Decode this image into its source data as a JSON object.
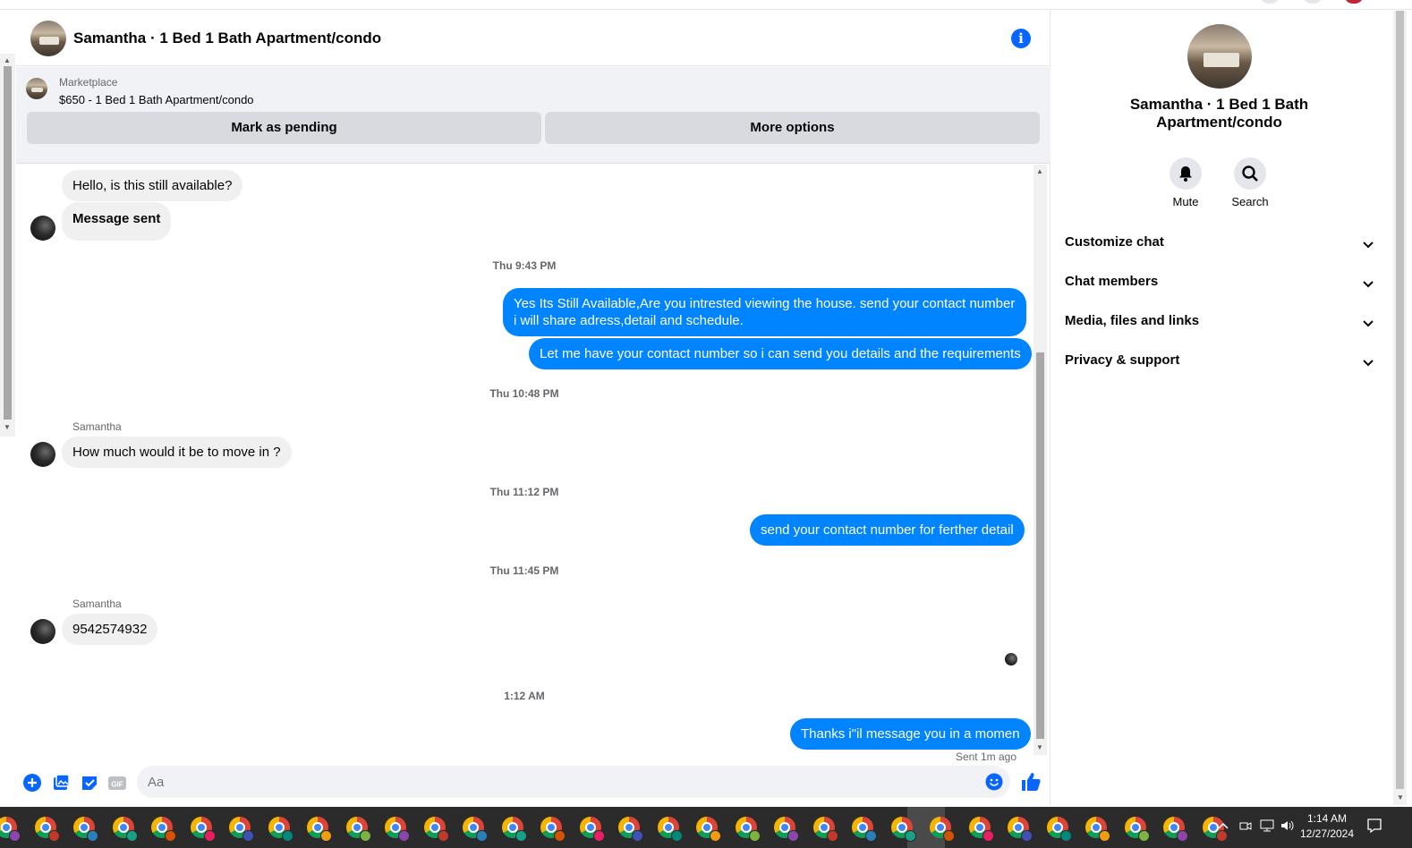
{
  "chat": {
    "title": "Samantha · 1 Bed 1 Bath Apartment/condo",
    "marketplace_label": "Marketplace",
    "listing": "$650 - 1 Bed 1 Bath Apartment/condo",
    "mark_pending": "Mark as pending",
    "more_options": "More options"
  },
  "messages": {
    "m1": "Hello, is this still available?",
    "m2": "Message sent",
    "ts1": "Thu 9:43 PM",
    "m3": "Yes Its Still Available,Are you intrested viewing the house. send your contact number i will share adress,detail and schedule.",
    "m4": "Let me have your contact number so i can send you details and the requirements",
    "ts2": "Thu 10:48 PM",
    "sender1": "Samantha",
    "m5": "How much would it be to move in ?",
    "ts3": "Thu 11:12 PM",
    "m6": "send your contact number for ferther detail",
    "ts4": "Thu 11:45 PM",
    "sender2": "Samantha",
    "m7": "9542574932",
    "ts5": "1:12 AM",
    "m8": "Thanks i\"il message you in a momen",
    "status": "Sent 1m ago"
  },
  "composer": {
    "placeholder": "Aa"
  },
  "panel": {
    "title": "Samantha · 1 Bed 1 Bath Apartment/condo",
    "mute": "Mute",
    "search": "Search",
    "sections": [
      "Customize chat",
      "Chat members",
      "Media, files and links",
      "Privacy & support"
    ]
  },
  "taskbar": {
    "time": "1:14 AM",
    "date": "12/27/2024"
  },
  "colors": {
    "accent": "#0084ff",
    "brand": "#0866ff",
    "bubble_in": "#f0f0f0"
  }
}
